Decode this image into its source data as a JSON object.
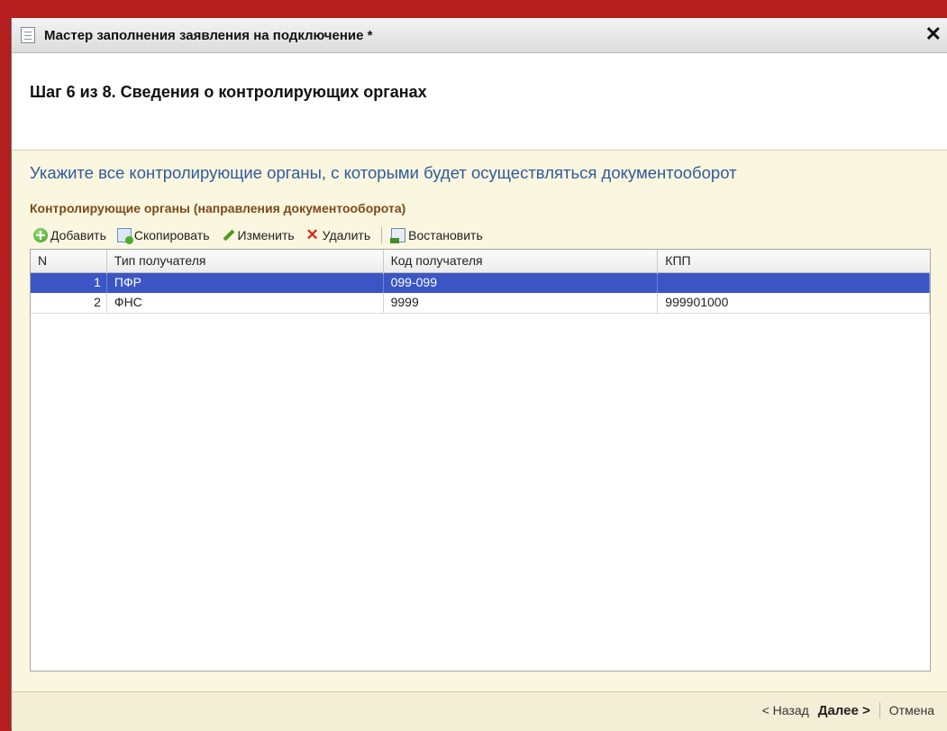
{
  "window": {
    "title": "Мастер заполнения заявления на подключение *",
    "close_glyph": "✕"
  },
  "header": {
    "step_title": "Шаг 6 из 8. Сведения о контролирующих органах"
  },
  "content": {
    "instruction": "Укажите все контролирующие органы, с которыми будет осуществляться документооборот",
    "group_title": "Контролирующие органы (направления документооборота)"
  },
  "toolbar": {
    "add_label": "Добавить",
    "copy_label": "Скопировать",
    "edit_label": "Изменить",
    "delete_label": "Удалить",
    "restore_label": "Востановить"
  },
  "table": {
    "columns": [
      "N",
      "Тип получателя",
      "Код получателя",
      "КПП"
    ],
    "rows": [
      {
        "n": "1",
        "type": "ПФР",
        "code": "099-099",
        "kpp": "",
        "selected": true
      },
      {
        "n": "2",
        "type": "ФНС",
        "code": "9999",
        "kpp": "999901000",
        "selected": false
      }
    ]
  },
  "footer": {
    "back_label": "< Назад",
    "next_label": "Далее >",
    "cancel_label": "Отмена"
  },
  "colors": {
    "selection": "#3b56c4",
    "instruction_text": "#2e5c9c",
    "group_title_text": "#7a4b1c",
    "content_bg": "#fbf6df"
  }
}
